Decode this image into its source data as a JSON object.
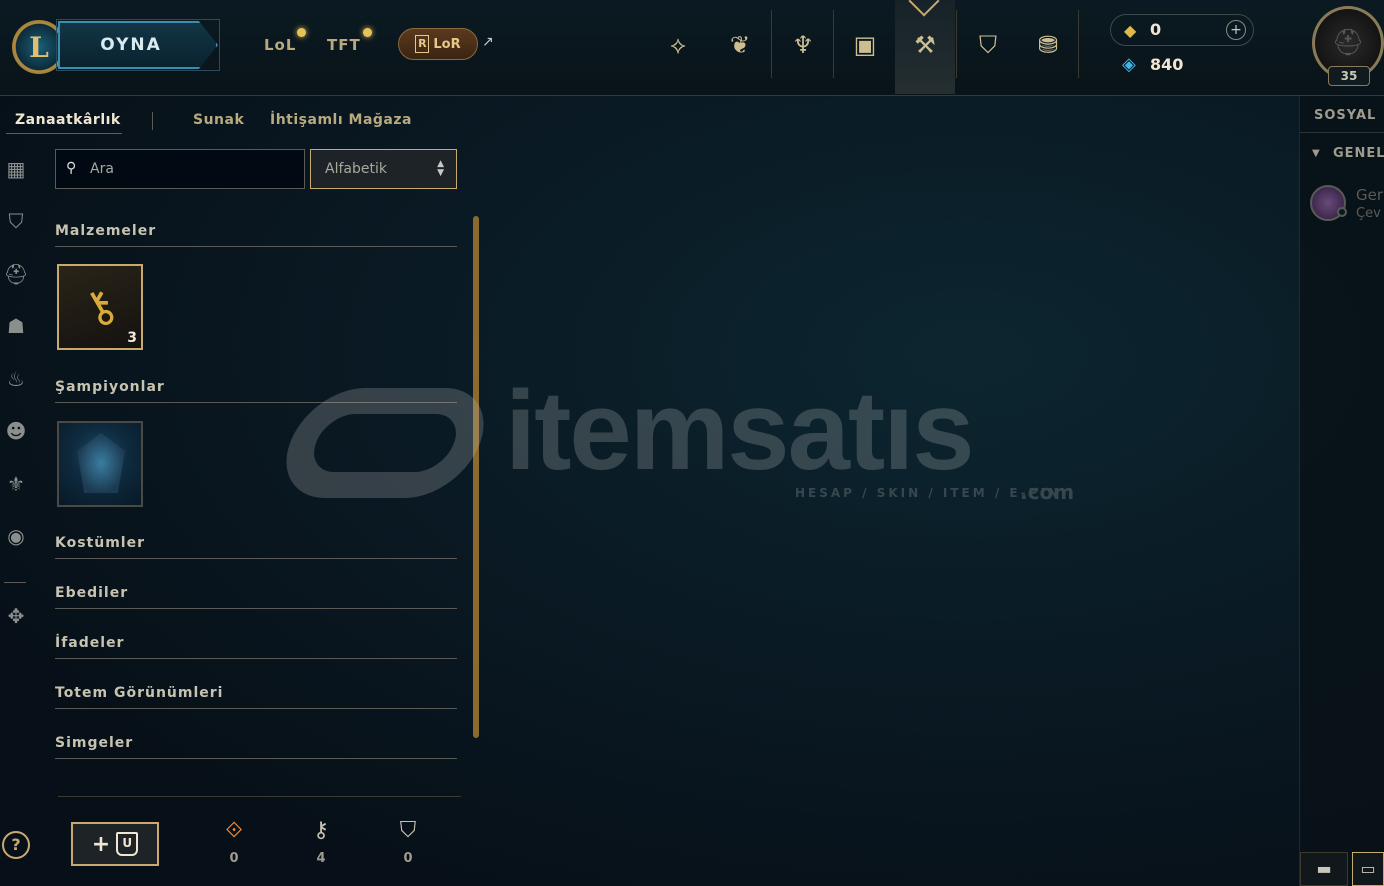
{
  "header": {
    "logo_letter": "L",
    "play_label": "OYNA",
    "game_tabs": [
      "LoL",
      "TFT"
    ],
    "lor_label": "LoR",
    "lor_mark": "R",
    "nav_icons": [
      "champion-icon",
      "skins-lotus-icon",
      "tft-chalice-icon",
      "collection-bag-icon",
      "loot-crafting-icon",
      "chest-icon",
      "store-coins-icon"
    ],
    "rp_value": "0",
    "be_value": "840",
    "plus_label": "+",
    "level": "35"
  },
  "subnav": {
    "tabs": [
      "Zanaatkârlık",
      "Sunak",
      "İhtişamlı Mağaza"
    ],
    "active": "Zanaatkârlık"
  },
  "search": {
    "placeholder": "Ara",
    "value": ""
  },
  "sort": {
    "selected": "Alfabetik"
  },
  "sections": {
    "materials": "Malzemeler",
    "champions": "Şampiyonlar",
    "skins": "Kostümler",
    "eternals": "Ebediler",
    "emotes": "İfadeler",
    "wards": "Totem Görünümleri",
    "icons": "Simgeler"
  },
  "materials_items": [
    {
      "name": "hextech-key",
      "count": "3"
    }
  ],
  "footer": {
    "add_plus": "+",
    "stats": [
      {
        "icon": "orange-essence-icon",
        "value": "0",
        "color": "#e8873a"
      },
      {
        "icon": "key-fragment-icon",
        "value": "4",
        "color": "#c8c3b0"
      },
      {
        "icon": "chest-icon",
        "value": "0",
        "color": "#c8c3b0"
      }
    ]
  },
  "help_label": "?",
  "watermark": {
    "brand": "itemsatıs",
    "tagline": "HESAP / SKIN / ITEM / E-PIN",
    "domain": ".com"
  },
  "social": {
    "title": "SOSYAL",
    "group": "GENEL",
    "friend_name": "Ger",
    "friend_status": "Çev"
  },
  "colors": {
    "gold": "#c8aa6e",
    "accent_blue": "#3fb5e8",
    "rp_gold": "#e0b84a"
  }
}
